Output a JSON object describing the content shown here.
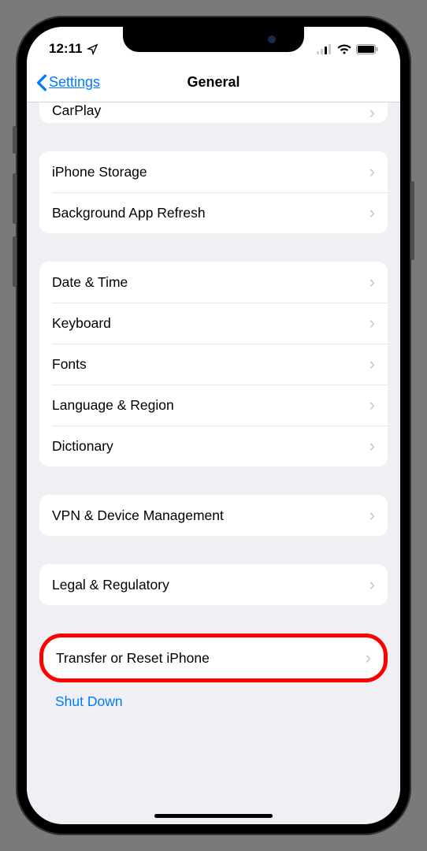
{
  "statusBar": {
    "time": "12:11"
  },
  "nav": {
    "back": "Settings",
    "title": "General"
  },
  "groups": [
    {
      "cut": true,
      "rows": [
        {
          "label": "CarPlay",
          "cut": true
        }
      ]
    },
    {
      "rows": [
        {
          "label": "iPhone Storage"
        },
        {
          "label": "Background App Refresh"
        }
      ]
    },
    {
      "rows": [
        {
          "label": "Date & Time"
        },
        {
          "label": "Keyboard"
        },
        {
          "label": "Fonts"
        },
        {
          "label": "Language & Region"
        },
        {
          "label": "Dictionary"
        }
      ]
    },
    {
      "rows": [
        {
          "label": "VPN & Device Management"
        }
      ]
    },
    {
      "rows": [
        {
          "label": "Legal & Regulatory"
        }
      ]
    },
    {
      "highlight": true,
      "rows": [
        {
          "label": "Transfer or Reset iPhone"
        }
      ]
    }
  ],
  "shutdown": "Shut Down"
}
